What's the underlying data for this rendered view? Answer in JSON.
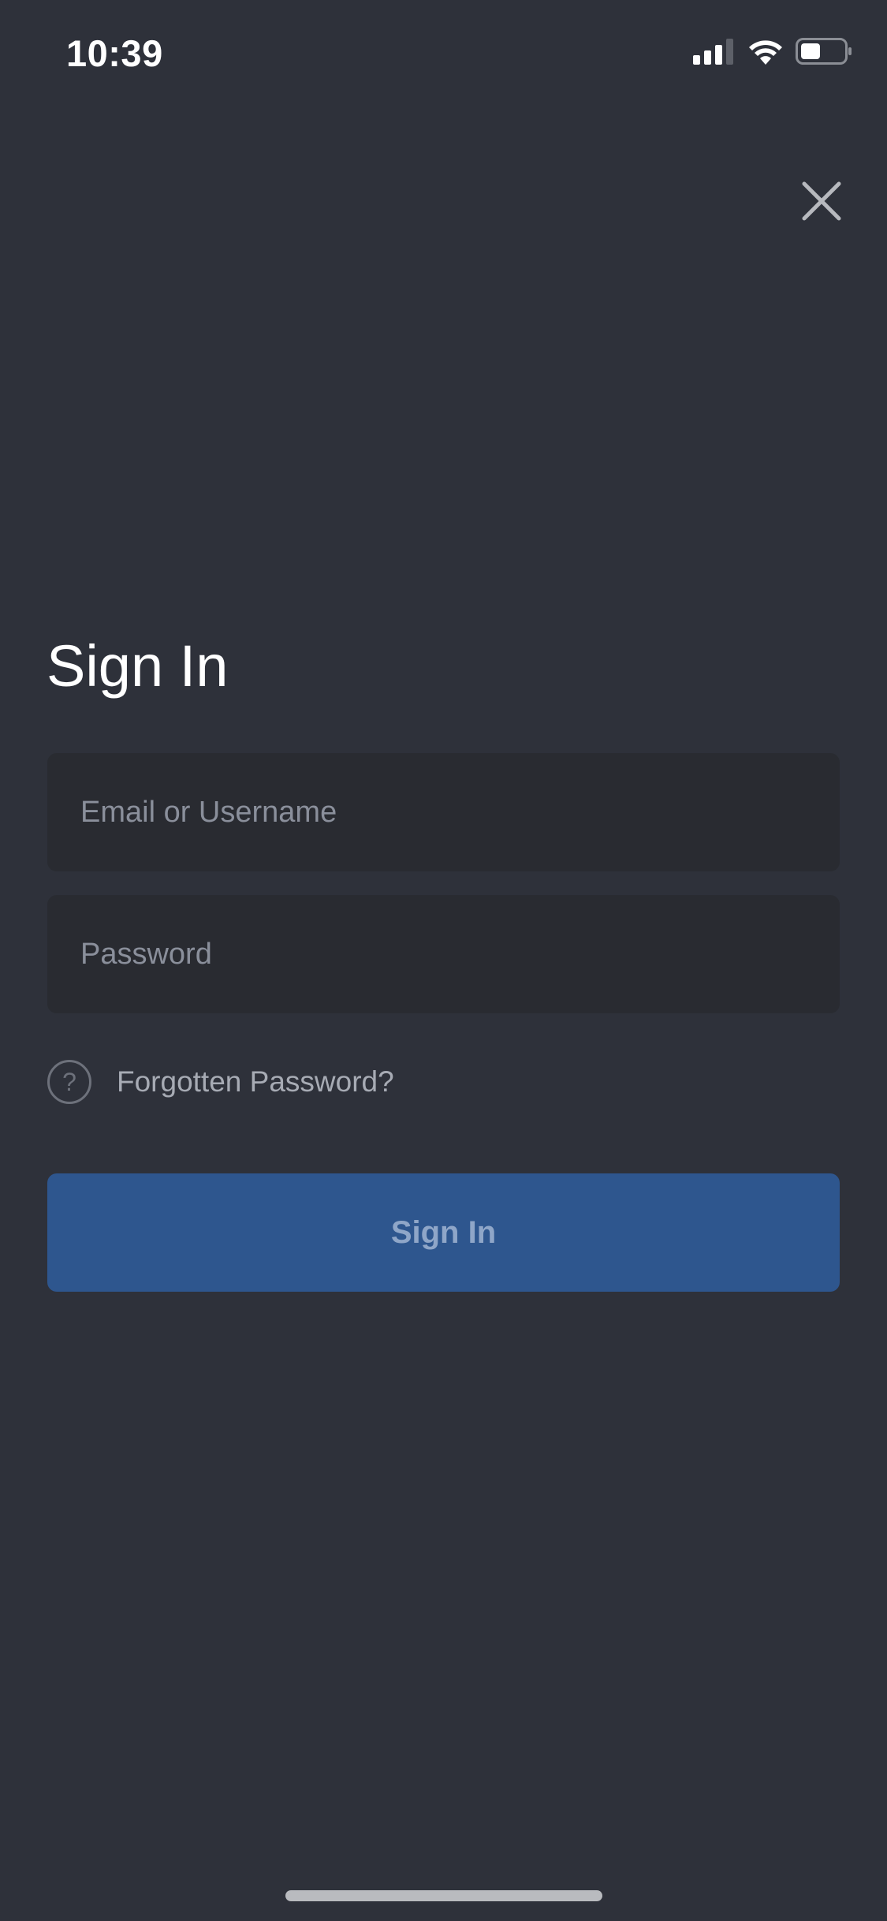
{
  "status_bar": {
    "time": "10:39",
    "icons": [
      "cellular-signal-icon",
      "wifi-icon",
      "battery-icon"
    ]
  },
  "close": {
    "icon": "close-icon"
  },
  "title": "Sign In",
  "form": {
    "email_placeholder": "Email or Username",
    "email_value": "",
    "password_placeholder": "Password",
    "password_value": "",
    "forgot_icon": "?",
    "forgot_label": "Forgotten Password?",
    "submit_label": "Sign In"
  },
  "colors": {
    "background": "#2e313a",
    "input_background": "#292b31",
    "primary_button": "#2e568e",
    "primary_button_text": "#8fa6c8"
  }
}
